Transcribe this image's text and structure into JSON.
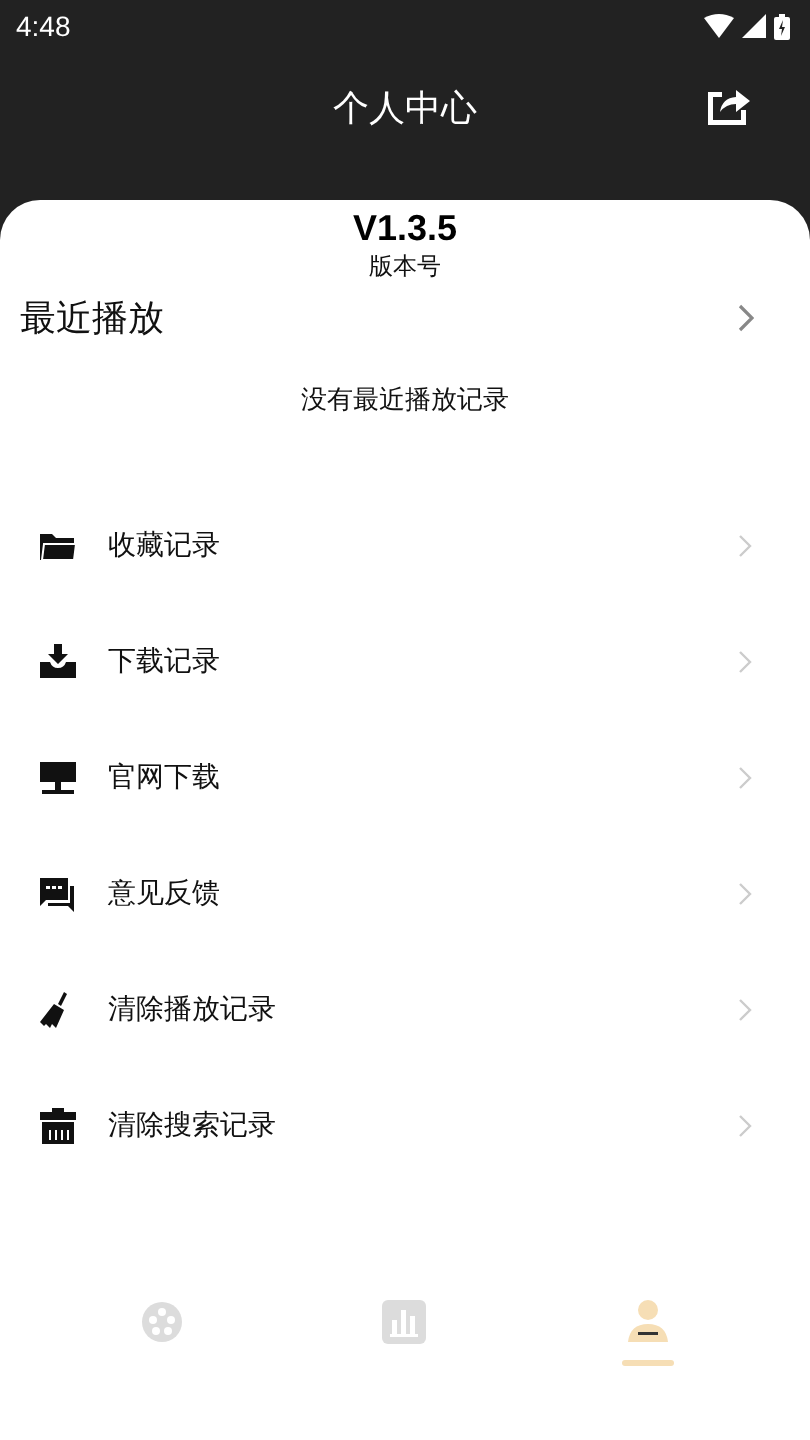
{
  "status_bar": {
    "time": "4:48"
  },
  "header": {
    "title": "个人中心"
  },
  "version": {
    "number": "V1.3.5",
    "label": "版本号"
  },
  "recent": {
    "title": "最近播放",
    "empty_text": "没有最近播放记录"
  },
  "menu": [
    {
      "kind": "folder",
      "label": "收藏记录"
    },
    {
      "kind": "download",
      "label": "下载记录"
    },
    {
      "kind": "monitor",
      "label": "官网下载"
    },
    {
      "kind": "feedback",
      "label": "意见反馈"
    },
    {
      "kind": "broom",
      "label": "清除播放记录"
    },
    {
      "kind": "trash",
      "label": "清除搜索记录"
    }
  ],
  "bottom_nav": [
    {
      "kind": "film",
      "selected": false
    },
    {
      "kind": "chart",
      "selected": false
    },
    {
      "kind": "person",
      "selected": true
    }
  ]
}
